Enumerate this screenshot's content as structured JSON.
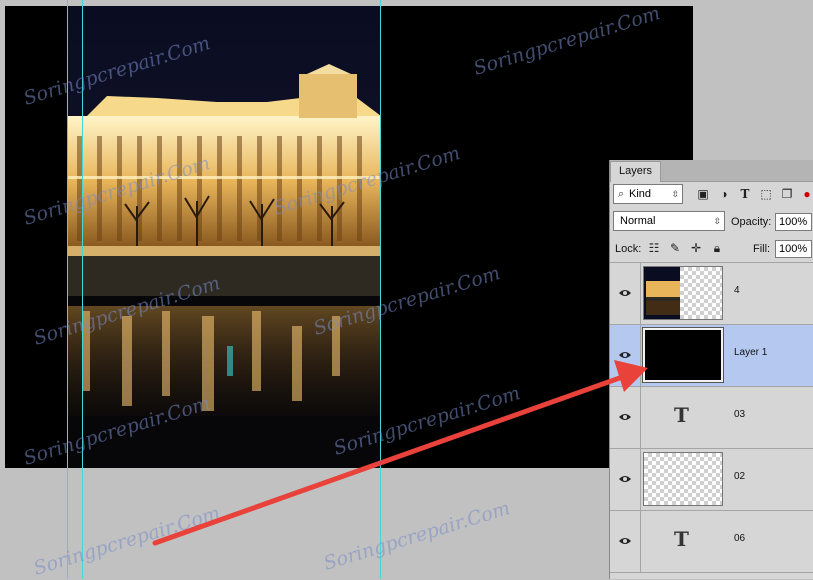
{
  "watermark": "Soringpcrepair.Com",
  "panel": {
    "tab": "Layers",
    "filter": {
      "kind_label": "Kind",
      "icons": [
        "image-filter-icon",
        "adjustment-filter-icon",
        "type-filter-icon",
        "shape-filter-icon",
        "smart-object-filter-icon"
      ]
    },
    "blend_mode": "Normal",
    "opacity_label": "Opacity:",
    "opacity_value": "100%",
    "lock_label": "Lock:",
    "lock_icons": [
      "lock-transparent-icon",
      "lock-paint-icon",
      "lock-move-icon",
      "lock-all-icon"
    ],
    "fill_label": "Fill:",
    "fill_value": "100%"
  },
  "layers": [
    {
      "name": "4",
      "thumb": "photo",
      "visible": true,
      "selected": false
    },
    {
      "name": "Layer 1",
      "thumb": "black",
      "visible": true,
      "selected": true
    },
    {
      "name": "03",
      "thumb": "text",
      "visible": true,
      "selected": false
    },
    {
      "name": "02",
      "thumb": "transparent",
      "visible": true,
      "selected": false
    },
    {
      "name": "06",
      "thumb": "text",
      "visible": true,
      "selected": false
    }
  ],
  "colors": {
    "guide": "#3fd9d9",
    "arrow": "#e8423a",
    "selected_layer": "#b5c9f0",
    "canvas_bg": "#000000"
  }
}
